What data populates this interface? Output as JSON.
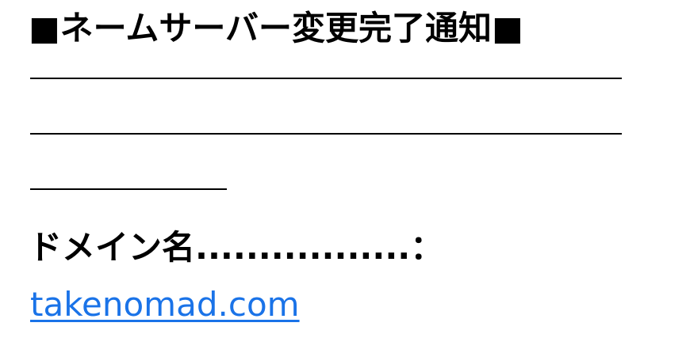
{
  "message": {
    "title": "■ネームサーバー変更完了通知■",
    "domain_label": "ドメイン名.................：",
    "domain_link": "takenomad.com"
  },
  "colors": {
    "text": "#000000",
    "link": "#1a73e8",
    "background": "#ffffff"
  }
}
